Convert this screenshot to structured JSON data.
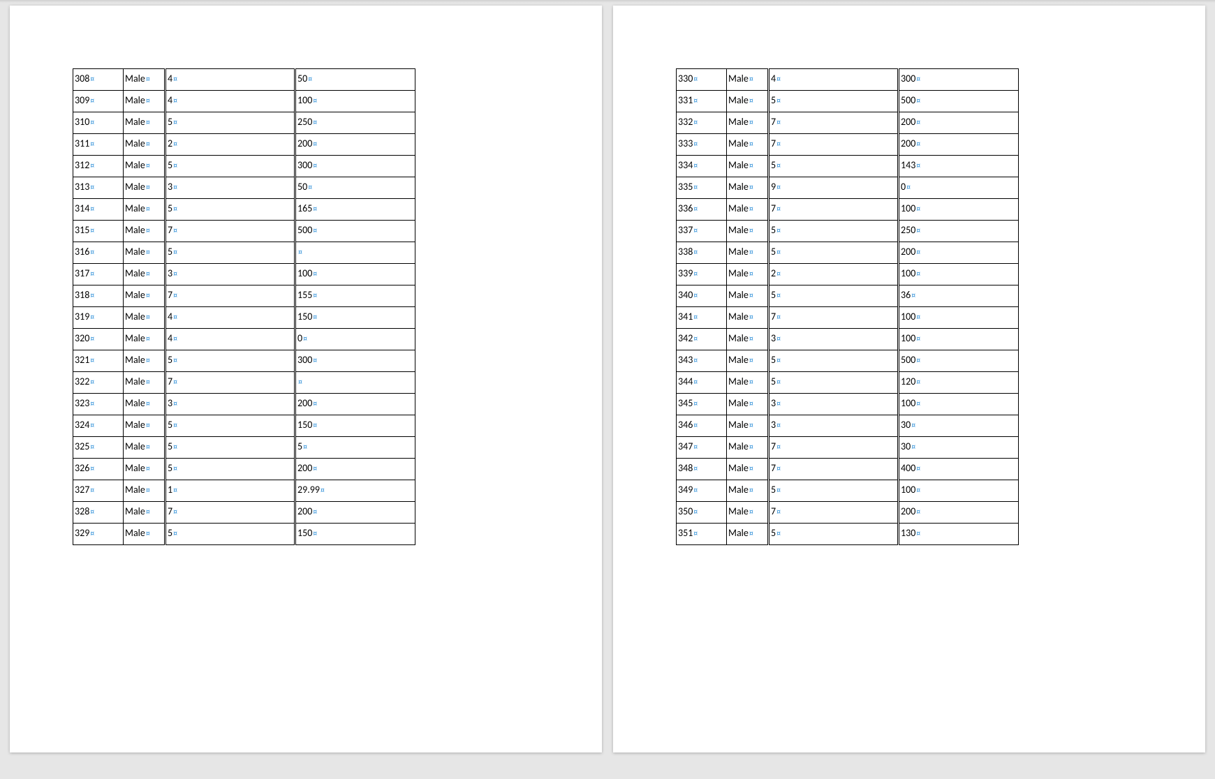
{
  "formatting_mark": "¤",
  "pages": [
    {
      "rows": [
        {
          "id": "308",
          "gender": "Male",
          "col3": "4",
          "col4": "50"
        },
        {
          "id": "309",
          "gender": "Male",
          "col3": "4",
          "col4": "100"
        },
        {
          "id": "310",
          "gender": "Male",
          "col3": "5",
          "col4": "250"
        },
        {
          "id": "311",
          "gender": "Male",
          "col3": "2",
          "col4": "200"
        },
        {
          "id": "312",
          "gender": "Male",
          "col3": "5",
          "col4": "300"
        },
        {
          "id": "313",
          "gender": "Male",
          "col3": "3",
          "col4": "50"
        },
        {
          "id": "314",
          "gender": "Male",
          "col3": "5",
          "col4": "165"
        },
        {
          "id": "315",
          "gender": "Male",
          "col3": "7",
          "col4": "500"
        },
        {
          "id": "316",
          "gender": "Male",
          "col3": "5",
          "col4": ""
        },
        {
          "id": "317",
          "gender": "Male",
          "col3": "3",
          "col4": "100"
        },
        {
          "id": "318",
          "gender": "Male",
          "col3": "7",
          "col4": "155"
        },
        {
          "id": "319",
          "gender": "Male",
          "col3": "4",
          "col4": "150"
        },
        {
          "id": "320",
          "gender": "Male",
          "col3": "4",
          "col4": "0"
        },
        {
          "id": "321",
          "gender": "Male",
          "col3": "5",
          "col4": "300"
        },
        {
          "id": "322",
          "gender": "Male",
          "col3": "7",
          "col4": ""
        },
        {
          "id": "323",
          "gender": "Male",
          "col3": "3",
          "col4": "200"
        },
        {
          "id": "324",
          "gender": "Male",
          "col3": "5",
          "col4": "150"
        },
        {
          "id": "325",
          "gender": "Male",
          "col3": "5",
          "col4": "5"
        },
        {
          "id": "326",
          "gender": "Male",
          "col3": "5",
          "col4": "200"
        },
        {
          "id": "327",
          "gender": "Male",
          "col3": "1",
          "col4": "29.99"
        },
        {
          "id": "328",
          "gender": "Male",
          "col3": "7",
          "col4": "200"
        },
        {
          "id": "329",
          "gender": "Male",
          "col3": "5",
          "col4": "150"
        }
      ]
    },
    {
      "rows": [
        {
          "id": "330",
          "gender": "Male",
          "col3": "4",
          "col4": "300"
        },
        {
          "id": "331",
          "gender": "Male",
          "col3": "5",
          "col4": "500"
        },
        {
          "id": "332",
          "gender": "Male",
          "col3": "7",
          "col4": "200"
        },
        {
          "id": "333",
          "gender": "Male",
          "col3": "7",
          "col4": "200"
        },
        {
          "id": "334",
          "gender": "Male",
          "col3": "5",
          "col4": "143"
        },
        {
          "id": "335",
          "gender": "Male",
          "col3": "9",
          "col4": "0"
        },
        {
          "id": "336",
          "gender": "Male",
          "col3": "7",
          "col4": "100"
        },
        {
          "id": "337",
          "gender": "Male",
          "col3": "5",
          "col4": "250"
        },
        {
          "id": "338",
          "gender": "Male",
          "col3": "5",
          "col4": "200"
        },
        {
          "id": "339",
          "gender": "Male",
          "col3": "2",
          "col4": "100"
        },
        {
          "id": "340",
          "gender": "Male",
          "col3": "5",
          "col4": "36"
        },
        {
          "id": "341",
          "gender": "Male",
          "col3": "7",
          "col4": "100"
        },
        {
          "id": "342",
          "gender": "Male",
          "col3": "3",
          "col4": "100"
        },
        {
          "id": "343",
          "gender": "Male",
          "col3": "5",
          "col4": "500"
        },
        {
          "id": "344",
          "gender": "Male",
          "col3": "5",
          "col4": "120"
        },
        {
          "id": "345",
          "gender": "Male",
          "col3": "3",
          "col4": "100"
        },
        {
          "id": "346",
          "gender": "Male",
          "col3": "3",
          "col4": "30"
        },
        {
          "id": "347",
          "gender": "Male",
          "col3": "7",
          "col4": "30"
        },
        {
          "id": "348",
          "gender": "Male",
          "col3": "7",
          "col4": "400"
        },
        {
          "id": "349",
          "gender": "Male",
          "col3": "5",
          "col4": "100"
        },
        {
          "id": "350",
          "gender": "Male",
          "col3": "7",
          "col4": "200"
        },
        {
          "id": "351",
          "gender": "Male",
          "col3": "5",
          "col4": "130"
        }
      ]
    }
  ]
}
